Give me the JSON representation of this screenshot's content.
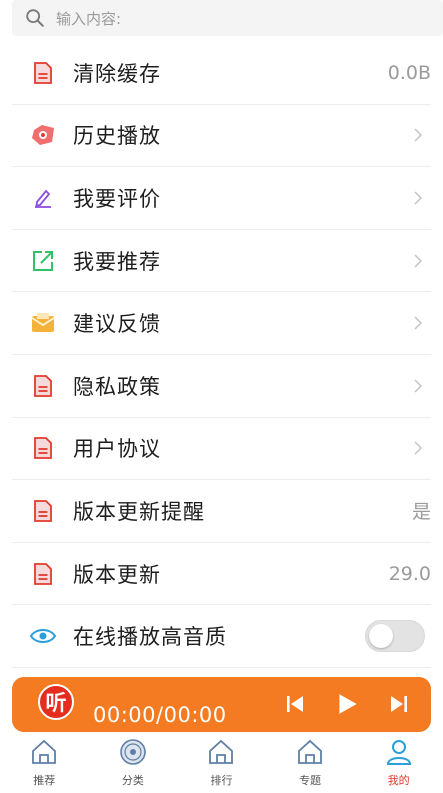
{
  "search": {
    "placeholder": "输入内容:"
  },
  "menu": {
    "items": [
      {
        "label": "清除缓存",
        "value": "0.0B",
        "icon": "document-icon"
      },
      {
        "label": "历史播放",
        "icon": "history-icon"
      },
      {
        "label": "我要评价",
        "icon": "pencil-icon"
      },
      {
        "label": "我要推荐",
        "icon": "share-icon"
      },
      {
        "label": "建议反馈",
        "icon": "envelope-icon"
      },
      {
        "label": "隐私政策",
        "icon": "document-icon"
      },
      {
        "label": "用户协议",
        "icon": "document-icon"
      },
      {
        "label": "版本更新提醒",
        "value": "是",
        "icon": "document-icon"
      },
      {
        "label": "版本更新",
        "value": "29.0",
        "icon": "document-icon"
      },
      {
        "label": "在线播放高音质",
        "icon": "eye-icon",
        "toggle_on": false
      }
    ]
  },
  "player": {
    "logo_text": "听",
    "time": "00:00/00:00"
  },
  "tabs": [
    {
      "label": "推荐",
      "icon": "home-icon"
    },
    {
      "label": "分类",
      "icon": "disc-icon"
    },
    {
      "label": "排行",
      "icon": "home-icon"
    },
    {
      "label": "专题",
      "icon": "home-icon"
    },
    {
      "label": "我的",
      "icon": "user-icon",
      "active": true
    }
  ],
  "colors": {
    "accent": "#f47b21",
    "red": "#e33a2c",
    "purple": "#8e4fe0",
    "green": "#2ec26b",
    "yellow": "#f4b23a",
    "blue": "#2a9fd8",
    "icon_gray": "#5e7fa6"
  }
}
